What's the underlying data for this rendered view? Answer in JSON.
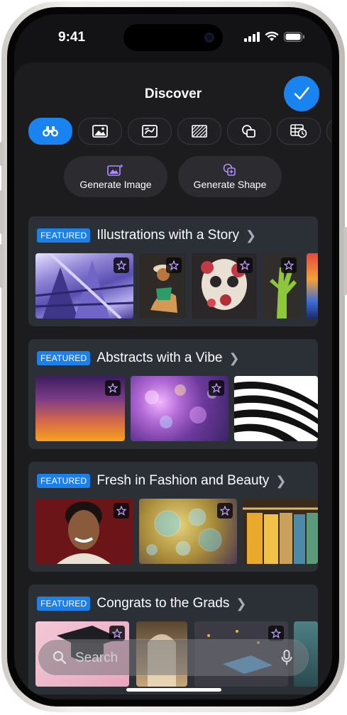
{
  "status_bar": {
    "time": "9:41"
  },
  "header": {
    "title": "Discover"
  },
  "categories": [
    {
      "icon": "binoculars-icon",
      "active": true
    },
    {
      "icon": "image-icon",
      "active": false
    },
    {
      "icon": "illustration-icon",
      "active": false
    },
    {
      "icon": "pattern-icon",
      "active": false
    },
    {
      "icon": "shapes-icon",
      "active": false
    },
    {
      "icon": "table-calendar-icon",
      "active": false
    }
  ],
  "actions": {
    "generate_image": "Generate Image",
    "generate_shape": "Generate Shape"
  },
  "sections": [
    {
      "badge": "FEATURED",
      "title": "Illustrations with a Story"
    },
    {
      "badge": "FEATURED",
      "title": "Abstracts with a Vibe"
    },
    {
      "badge": "FEATURED",
      "title": "Fresh in Fashion and Beauty"
    },
    {
      "badge": "FEATURED",
      "title": "Congrats to the Grads"
    }
  ],
  "search": {
    "placeholder": "Search"
  },
  "colors": {
    "accent": "#1983f0",
    "badge": "#1d7fe8",
    "card": "#2b2f36",
    "sheet": "#1c1c1f"
  }
}
